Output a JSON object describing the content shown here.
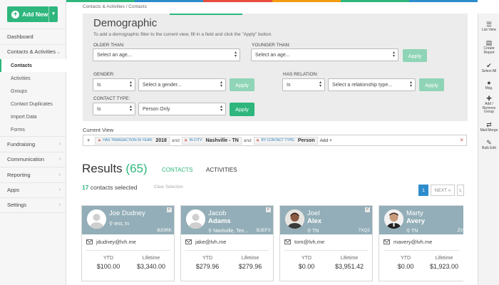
{
  "sidebar": {
    "add_new_label": "Add New",
    "items": [
      {
        "label": "Dashboard",
        "expandable": false
      },
      {
        "label": "Contacts & Activities",
        "expandable": true,
        "expanded": true
      },
      {
        "label": "Fundraising",
        "expandable": true
      },
      {
        "label": "Communication",
        "expandable": true
      },
      {
        "label": "Reporting",
        "expandable": true
      },
      {
        "label": "Apps",
        "expandable": true
      },
      {
        "label": "Settings",
        "expandable": true
      }
    ],
    "subitems": [
      "Contacts",
      "Activities",
      "Groups",
      "Contact Duplicates",
      "Import Data",
      "Forms"
    ],
    "active_subitem": "Contacts"
  },
  "top_colors": [
    "#2eb67d",
    "#2d8ccc",
    "#e74c3c",
    "#f39c12",
    "#2eb67d",
    "#2d8ccc"
  ],
  "breadcrumb": "Contacts & Activities / Contacts",
  "filter": {
    "title": "Demographic",
    "description": "To add a demographic filter to the current view, fill in a field and click the \"Apply\" button.",
    "older_than_label": "OLDER THAN:",
    "older_than_value": "Select an age...",
    "younger_than_label": "YOUNGER THAN:",
    "younger_than_value": "Select an age...",
    "gender_label": "GENDER:",
    "gender_op": "Is",
    "gender_value": "Select a gender...",
    "relation_label": "HAS RELATION:",
    "relation_op": "Is",
    "relation_value": "Select a relationship type...",
    "contact_type_label": "CONTACT TYPE:",
    "contact_type_op": "Is",
    "contact_type_value": "Person Only",
    "apply_label": "Apply"
  },
  "current_view": {
    "label": "Current View",
    "chips": [
      {
        "key": "HAS TRANSACTION IN YEAR:",
        "value": "2018"
      },
      {
        "key": "IN CITY:",
        "value": "Nashville - TN"
      },
      {
        "key": "BY CONTACT TYPE:",
        "value": "Person"
      }
    ],
    "and_label": "and",
    "add_label": "Add +"
  },
  "results": {
    "title": "Results",
    "count": "(65)",
    "tab_contacts": "CONTACTS",
    "tab_activities": "ACTIVITIES",
    "selected_count": "17",
    "selected_text": "contacts selected",
    "clear_selection": "Clear Selection",
    "page": "1",
    "next_label": "NEXT »",
    "last_label": "L"
  },
  "contacts": [
    {
      "first": "Joe Dudney",
      "last": "",
      "location": "test, tn",
      "code": "B20RK",
      "email": "jdudney@lvh.me",
      "ytd_label": "YTD",
      "ytd": "$100.00",
      "lifetime_label": "Lifetime",
      "lifetime": "$3,340.00",
      "photo": false
    },
    {
      "first": "Jacob",
      "last": "Adams",
      "location": "Nashville, Ten...",
      "code": "BJEFX",
      "email": "jake@lvh.me",
      "ytd_label": "YTD",
      "ytd": "$279.96",
      "lifetime_label": "Lifetime",
      "lifetime": "$279.96",
      "photo": false
    },
    {
      "first": "Joel",
      "last": "Alex",
      "location": "TN",
      "code": "7XQ2",
      "email": "tom@lvh.me",
      "ytd_label": "YTD",
      "ytd": "$0.00",
      "lifetime_label": "Lifetime",
      "lifetime": "$3,951.42",
      "photo": true
    },
    {
      "first": "Marty",
      "last": "Avery",
      "location": "TN",
      "code": "ZV",
      "email": "mavery@lvh.me",
      "ytd_label": "YTD",
      "ytd": "$0.00",
      "lifetime_label": "Lifetime",
      "lifetime": "$1,923.00",
      "photo": true
    }
  ],
  "toolbar": [
    {
      "icon": "list-icon",
      "label": "List View"
    },
    {
      "icon": "report-icon",
      "label": "Create Report"
    },
    {
      "icon": "check-icon",
      "label": "Select All"
    },
    {
      "icon": "message-icon",
      "label": "Msg."
    },
    {
      "icon": "group-icon",
      "label": "Add / Remove Group"
    },
    {
      "icon": "merge-icon",
      "label": "Mail Merge"
    },
    {
      "icon": "edit-icon",
      "label": "Bulk Edit"
    }
  ]
}
